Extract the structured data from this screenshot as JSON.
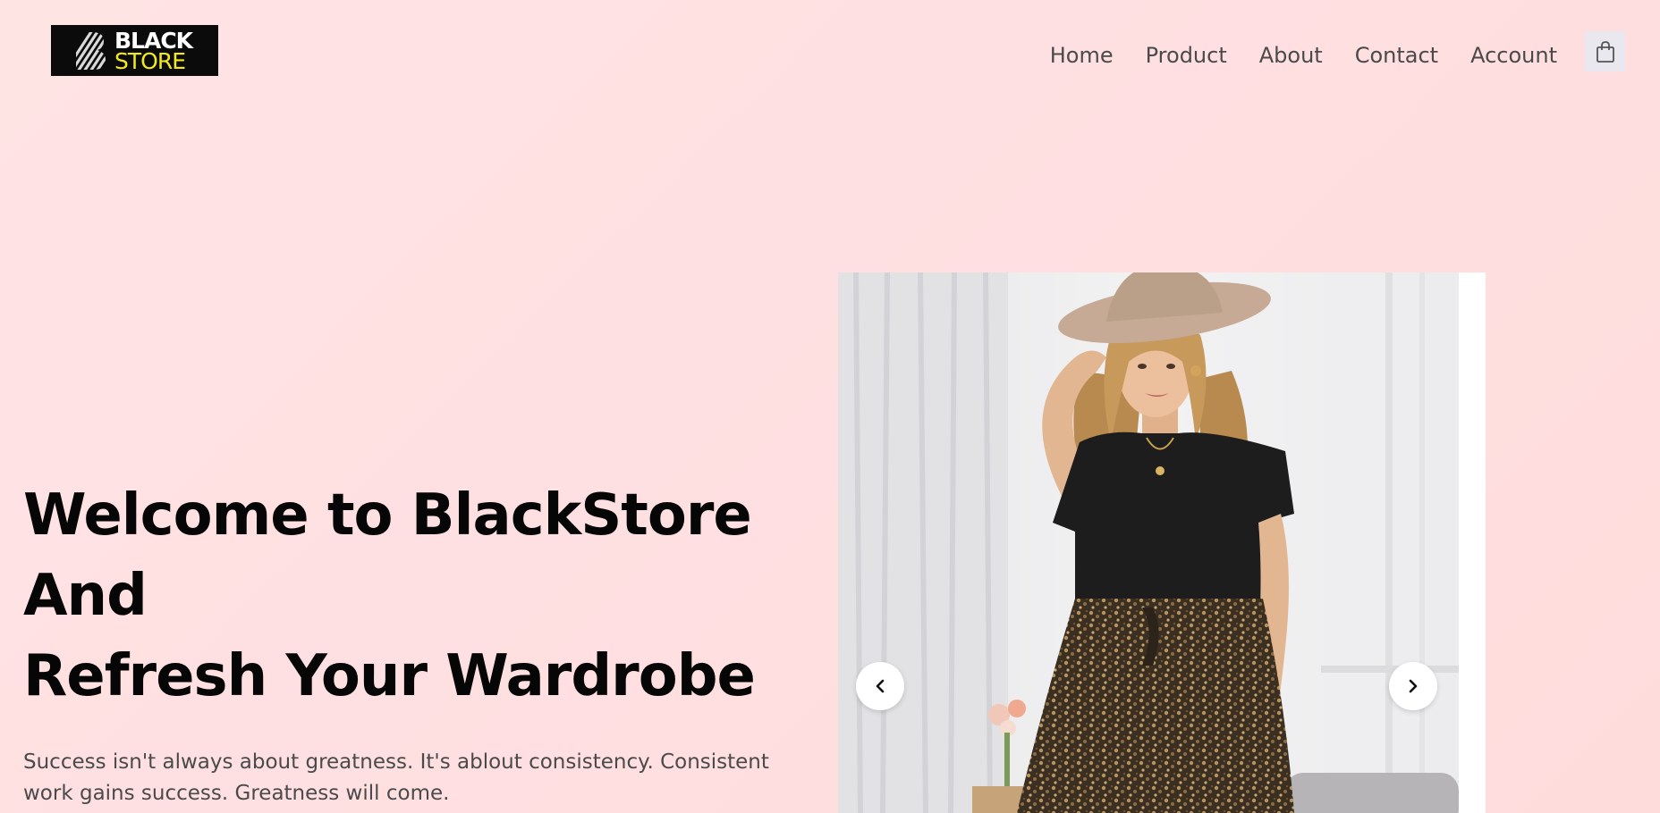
{
  "header": {
    "logo": {
      "line1": "BLACK",
      "line2": "STORE"
    },
    "nav": [
      {
        "label": "Home"
      },
      {
        "label": "Product"
      },
      {
        "label": "About"
      },
      {
        "label": "Contact"
      },
      {
        "label": "Account"
      }
    ],
    "cart_icon": "shopping-bag-icon"
  },
  "hero": {
    "title_lines": [
      "Welcome to BlackStore",
      "And",
      "Refresh Your Wardrobe"
    ],
    "description": "Success isn't always about greatness. It's ablout consistency. Consistent work gains success. Greatness will come."
  },
  "slider": {
    "prev_icon": "chevron-left-icon",
    "next_icon": "chevron-right-icon"
  },
  "colors": {
    "background": "#ffe0e2",
    "logo_bg": "#0b0b0b",
    "logo_accent": "#f3ea1c",
    "heading": "#060606",
    "body_text": "#4a4a4a"
  }
}
